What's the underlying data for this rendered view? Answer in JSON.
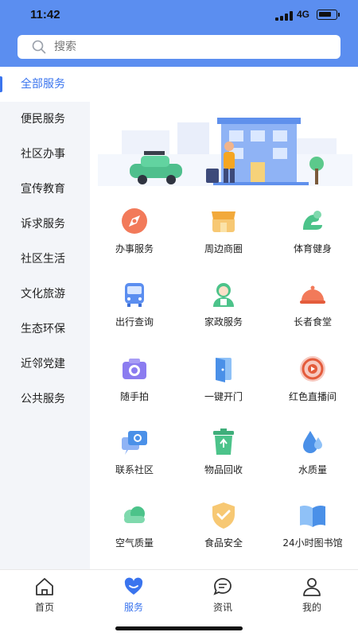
{
  "status": {
    "time": "11:42",
    "network": "4G"
  },
  "search": {
    "placeholder": "搜索",
    "icon": "search-icon"
  },
  "sidebar": {
    "items": [
      {
        "label": "全部服务",
        "active": true
      },
      {
        "label": "便民服务"
      },
      {
        "label": "社区办事"
      },
      {
        "label": "宣传教育"
      },
      {
        "label": "诉求服务"
      },
      {
        "label": "社区生活"
      },
      {
        "label": "文化旅游"
      },
      {
        "label": "生态环保"
      },
      {
        "label": "近邻党建"
      },
      {
        "label": "公共服务"
      }
    ]
  },
  "services": [
    {
      "label": "办事服务",
      "icon": "compass-icon"
    },
    {
      "label": "周边商圈",
      "icon": "shop-icon"
    },
    {
      "label": "体育健身",
      "icon": "muscle-icon"
    },
    {
      "label": "出行查询",
      "icon": "bus-icon"
    },
    {
      "label": "家政服务",
      "icon": "housekeeper-icon"
    },
    {
      "label": "长者食堂",
      "icon": "food-cloche-icon"
    },
    {
      "label": "随手拍",
      "icon": "camera-icon"
    },
    {
      "label": "一键开门",
      "icon": "door-icon"
    },
    {
      "label": "红色直播间",
      "icon": "live-broadcast-icon"
    },
    {
      "label": "联系社区",
      "icon": "chat-bubble-icon"
    },
    {
      "label": "物品回收",
      "icon": "recycle-bin-icon"
    },
    {
      "label": "水质量",
      "icon": "water-drop-icon"
    },
    {
      "label": "空气质量",
      "icon": "cloud-icon"
    },
    {
      "label": "食品安全",
      "icon": "shield-check-icon"
    },
    {
      "label": "24小时图书馆",
      "icon": "book-icon"
    }
  ],
  "tabbar": {
    "items": [
      {
        "label": "首页",
        "icon": "home-icon"
      },
      {
        "label": "服务",
        "icon": "heart-icon",
        "active": true
      },
      {
        "label": "资讯",
        "icon": "message-icon"
      },
      {
        "label": "我的",
        "icon": "user-icon"
      }
    ]
  },
  "colors": {
    "accent": "#3a74ee",
    "header": "#5b8ef0",
    "sidebar_bg": "#f3f5f9"
  }
}
